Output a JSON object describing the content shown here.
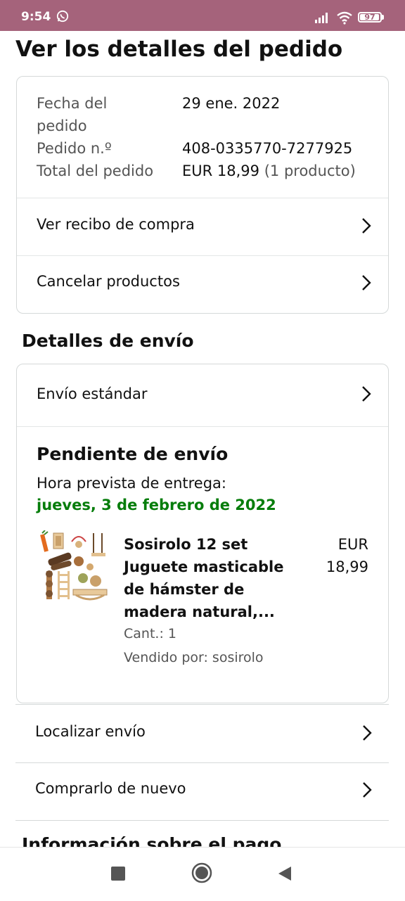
{
  "status_bar": {
    "time": "9:54",
    "battery": "97",
    "battery_level": 0.97
  },
  "page_title": "Ver los detalles del pedido",
  "order_summary": {
    "date_label_line1": "Fecha del",
    "date_label_line2": "pedido",
    "date_value": "29 ene. 2022",
    "number_label": "Pedido n.º",
    "number_value": "408-0335770-7277925",
    "total_label": "Total del pedido",
    "total_value": "EUR 18,99",
    "total_items": "(1 producto)"
  },
  "actions": {
    "receipt": "Ver recibo de compra",
    "cancel": "Cancelar productos"
  },
  "shipping": {
    "section_title": "Detalles de envío",
    "method": "Envío estándar",
    "status": "Pendiente de envío",
    "eta_label": "Hora prevista de entrega:",
    "eta_date": "jueves, 3 de febrero de 2022",
    "product": {
      "name_lines": [
        "Sosirolo 12 set",
        "Juguete masticable",
        "de hámster de",
        "madera natural,..."
      ],
      "price_currency": "EUR",
      "price_amount": "18,99",
      "quantity": "Cant.: 1",
      "seller": "Vendido por: sosirolo"
    }
  },
  "links": {
    "track": "Localizar envío",
    "buy_again": "Comprarlo de nuevo"
  },
  "next_section_partial": "Información sobre el pago",
  "colors": {
    "status_bar": "#a5637b",
    "delivery_green": "#067d0b"
  }
}
